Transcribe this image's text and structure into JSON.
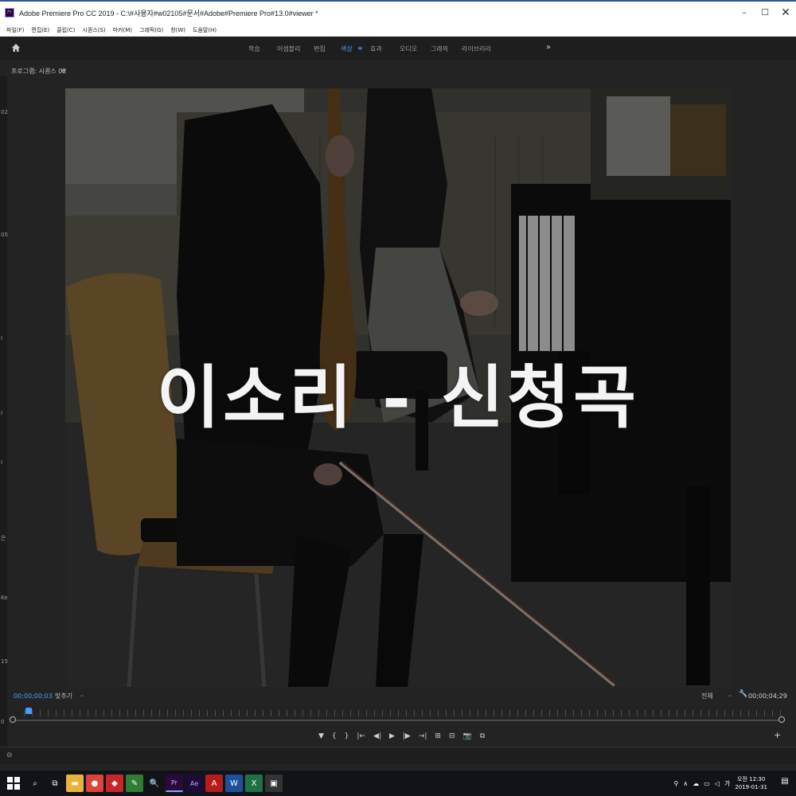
{
  "window": {
    "title": "Adobe Premiere Pro CC 2019 - C:\\#사용자#w02105#문서#Adobe#Premiere Pro#13.0#viewer *",
    "minimize": "–",
    "maximize": "☐",
    "close": "✕"
  },
  "menu": [
    "파일(F)",
    "편집(E)",
    "클립(C)",
    "시퀀스(S)",
    "마커(M)",
    "그래픽(G)",
    "창(W)",
    "도움말(H)"
  ],
  "workspace": {
    "tabs": [
      "학습",
      "어셈블리",
      "편집",
      "색상",
      "효과",
      "오디오",
      "그래픽",
      "라이브러리"
    ],
    "active_tab": "색상",
    "more": "»"
  },
  "panel": {
    "title": "프로그램: 시퀀스 02",
    "menu": "≡"
  },
  "left_strip_labels": [
    "02",
    "05",
    "I",
    "I",
    "I",
    "은",
    "Ke",
    "15",
    "0"
  ],
  "video": {
    "overlay_title": "이소리 - 신청곡"
  },
  "playback": {
    "current_timecode": "00;00;00;03",
    "fit": "맞추기",
    "resolution": "전체",
    "duration_timecode": "00;00;04;29"
  },
  "transport": [
    "▼",
    "{",
    "}",
    "|←",
    "◀|",
    "▶",
    "|▶",
    "→|",
    "⊞",
    "⊟",
    "📷",
    "⧉"
  ],
  "add_button": "+",
  "taskbar": {
    "icons": [
      {
        "name": "search",
        "glyph": "⌕",
        "color": "#101418"
      },
      {
        "name": "task-view",
        "glyph": "⧉",
        "color": "#101418"
      },
      {
        "name": "file-explorer",
        "glyph": "▬",
        "color": "#e8b33a"
      },
      {
        "name": "chrome",
        "glyph": "●",
        "color": "#db4437"
      },
      {
        "name": "app-red",
        "glyph": "◆",
        "color": "#c62828"
      },
      {
        "name": "app-green",
        "glyph": "✎",
        "color": "#2e7d32"
      },
      {
        "name": "search-app",
        "glyph": "🔍",
        "color": "#101418"
      },
      {
        "name": "premiere",
        "glyph": "Pr",
        "color": "#2a0a3a"
      },
      {
        "name": "after-effects",
        "glyph": "Ae",
        "color": "#1f0a3a"
      },
      {
        "name": "acrobat",
        "glyph": "A",
        "color": "#b71c1c"
      },
      {
        "name": "word",
        "glyph": "W",
        "color": "#1e4f9c"
      },
      {
        "name": "excel",
        "glyph": "X",
        "color": "#1e7145"
      },
      {
        "name": "photos",
        "glyph": "▣",
        "color": "#333"
      }
    ],
    "tray": [
      "⚲",
      "∧",
      "☁",
      "▭",
      "◁",
      "가"
    ],
    "time": "오전 12:30",
    "date": "2019-01-31",
    "notifications": "▤"
  }
}
